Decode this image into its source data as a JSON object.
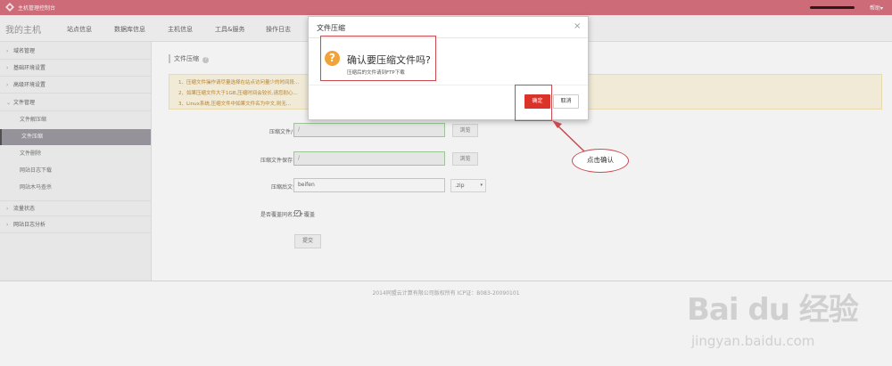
{
  "topbar": {
    "app_title": "主机管理控制台",
    "help": "帮助▾"
  },
  "navbar": {
    "my_host": "我的主机",
    "items": [
      "站点信息",
      "数据库信息",
      "主机信息",
      "工具&服务",
      "操作日志"
    ]
  },
  "sidebar": {
    "items": [
      {
        "label": "域名管理",
        "arrow": "›"
      },
      {
        "label": "基础环境设置",
        "arrow": "›"
      },
      {
        "label": "高级环境设置",
        "arrow": "›"
      },
      {
        "label": "文件管理",
        "arrow": "⌄"
      },
      {
        "label": "流量状态",
        "arrow": "›"
      },
      {
        "label": "网站日志分析",
        "arrow": "›"
      }
    ],
    "subitems": [
      "文件解压缩",
      "文件压缩",
      "文件删除",
      "网站日志下载",
      "网站木马查杀"
    ],
    "active_subitem": "文件压缩"
  },
  "content": {
    "section_title": "文件压缩",
    "section_help": "?",
    "notice": [
      "1、压缩文件操作请尽量选择在站点访问量少的时间段...",
      "2、如果压缩文件大于1GB,压缩时间会较长,请您耐心...",
      "3、Linux系统,压缩文件中如果文件名为中文,则无..."
    ],
    "form": {
      "source_label": "压缩文件/目录：",
      "source_value": "/",
      "source_browse": "浏览",
      "save_label": "压缩文件保存目录：",
      "save_value": "/",
      "save_browse": "浏览",
      "name_label": "压缩后文件名：",
      "name_value": "beifen",
      "ext_value": ".zip",
      "overwrite_label": "是否覆盖同名文件：",
      "overwrite_option": "覆盖",
      "submit": "提交"
    }
  },
  "footer": {
    "text": "2014同盟云计算有限公司版权所有 ICP证：B083-20090101"
  },
  "dialog": {
    "title": "文件压缩",
    "close": "×",
    "icon": "question-icon",
    "icon_glyph": "?",
    "question": "确认要压缩文件吗?",
    "subtext": "压缩后的文件请到FTP下载",
    "ok": "确定",
    "cancel": "取消"
  },
  "annotation": {
    "callout": "点击确认",
    "color": "#c9494f"
  },
  "watermark": {
    "main": "Bai du 经验",
    "sub": "jingyan.baidu.com"
  },
  "colors": {
    "topbar": "#d8717f",
    "ok_button": "#d9332a",
    "active_sidebar": "#9e9aa2",
    "notice_bg": "#fdf7e3",
    "icon_orange": "#f0a33a"
  }
}
